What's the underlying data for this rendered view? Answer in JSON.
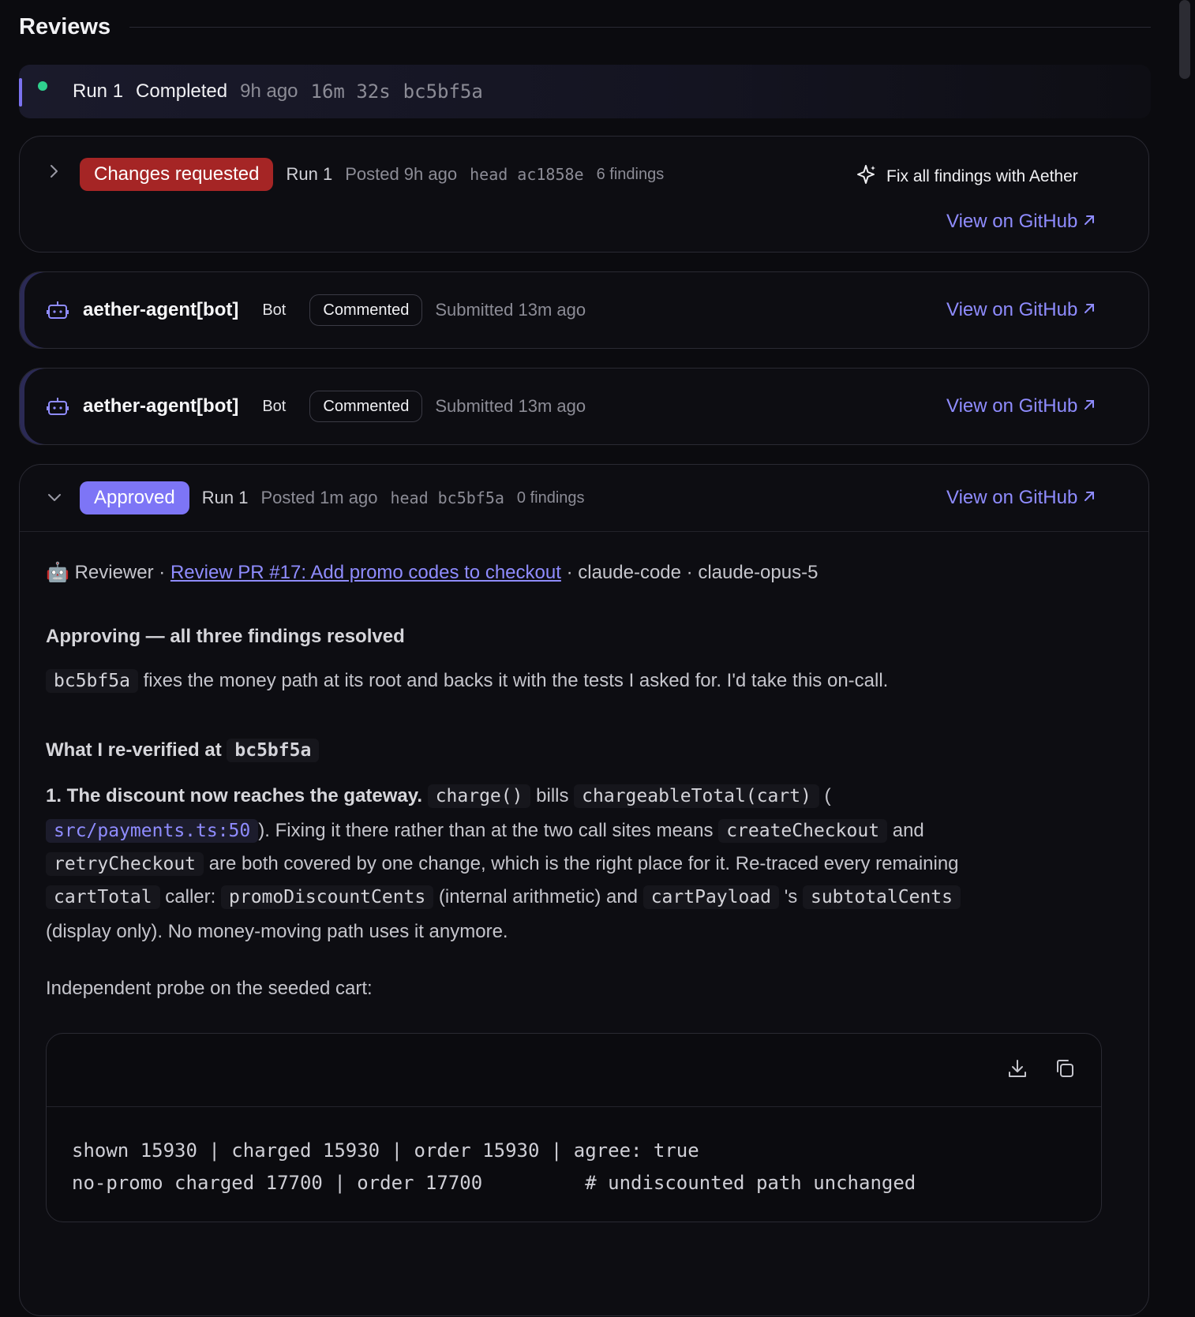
{
  "header": {
    "title": "Reviews"
  },
  "run_strip": {
    "run": "Run 1",
    "status": "Completed",
    "age": "9h ago",
    "duration": "16m 32s",
    "commit": "bc5bf5a",
    "status_color": "#2fd08e"
  },
  "review_changes": {
    "status": "Changes requested",
    "run": "Run 1",
    "posted": "Posted 9h ago",
    "head_label": "head",
    "head_commit": "ac1858e",
    "findings": "6 findings",
    "fix_label": "Fix all findings with Aether",
    "github_label": "View on GitHub",
    "status_color": "#a52525"
  },
  "bot_reviews": [
    {
      "name": "aether-agent[bot]",
      "tag": "Bot",
      "status": "Commented",
      "submitted": "Submitted 13m ago",
      "github_label": "View on GitHub"
    },
    {
      "name": "aether-agent[bot]",
      "tag": "Bot",
      "status": "Commented",
      "submitted": "Submitted 13m ago",
      "github_label": "View on GitHub"
    }
  ],
  "review_approved": {
    "status": "Approved",
    "run": "Run 1",
    "posted": "Posted 1m ago",
    "head_label": "head",
    "head_commit": "bc5bf5a",
    "findings": "0 findings",
    "github_label": "View on GitHub",
    "status_color": "#7d75f6",
    "meta": {
      "emoji": "🤖",
      "role": "Reviewer",
      "sep": "·",
      "link": "Review PR #17: Add promo codes to checkout",
      "tool": "claude-code",
      "model": "claude-opus-5"
    },
    "title": "Approving — all three findings resolved",
    "summary": {
      "commit": "bc5bf5a",
      "text": "fixes the money path at its root and backs it with the tests I asked for. I'd take this on-call."
    },
    "verified_heading": {
      "text": "What I re-verified at",
      "commit": "bc5bf5a"
    },
    "point1": {
      "lead": "1. The discount now reaches the gateway.",
      "code_charge": "charge()",
      "w_bills": "bills",
      "code_total": "chargeableTotal(cart)",
      "open_paren": "(",
      "code_src": "src/payments.ts:50",
      "t_fix": "). Fixing it there rather than at the two call sites means",
      "code_create": "createCheckout",
      "w_and": "and",
      "code_retry": "retryCheckout",
      "t_covered": "are both covered by one change, which is the right place for it. Re-traced every remaining",
      "code_carttotal": "cartTotal",
      "w_caller": "caller:",
      "code_promo": "promoDiscountCents",
      "t_internal": "(internal arithmetic) and",
      "code_payload": "cartPayload",
      "w_s": "'s",
      "code_subtotal": "subtotalCents",
      "t_display": "(display only). No money-moving path uses it anymore."
    },
    "probe_intro": "Independent probe on the seeded cart:",
    "code_lines": [
      "shown 15930 | charged 15930 | order 15930 | agree: true",
      "no-promo charged 17700 | order 17700         # undiscounted path unchanged"
    ],
    "code_icons": [
      "download-icon",
      "copy-icon"
    ]
  },
  "colors": {
    "accent": "#8f8cff",
    "background": "#0b0b0f"
  }
}
